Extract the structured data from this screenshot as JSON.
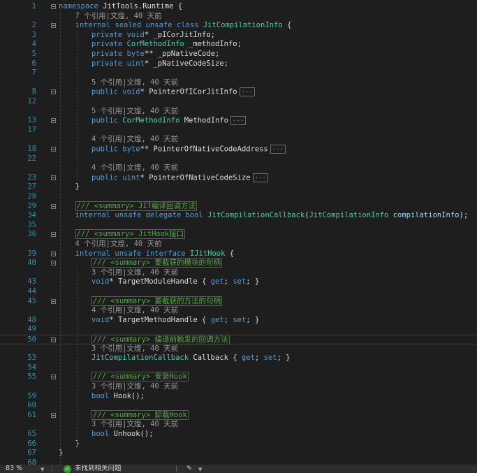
{
  "editor": {
    "lines": [
      {
        "ln": "1",
        "fold": true,
        "code": [
          [
            "kw",
            "namespace"
          ],
          [
            "id",
            " JitTools.Runtime {"
          ]
        ]
      },
      {
        "ln": "",
        "lens": "7 个引用|文煌, 40 天前",
        "indent": 1
      },
      {
        "ln": "2",
        "fold": true,
        "indent": 1,
        "code": [
          [
            "kw",
            "internal sealed unsafe class "
          ],
          [
            "ty",
            "JitCompilationInfo"
          ],
          [
            "id",
            " {"
          ]
        ]
      },
      {
        "ln": "3",
        "indent": 2,
        "code": [
          [
            "kw",
            "private void"
          ],
          [
            "id",
            "* _pICorJitInfo;"
          ]
        ]
      },
      {
        "ln": "4",
        "indent": 2,
        "code": [
          [
            "kw",
            "private "
          ],
          [
            "ty",
            "CorMethodInfo"
          ],
          [
            "id",
            " _methodInfo;"
          ]
        ]
      },
      {
        "ln": "5",
        "indent": 2,
        "code": [
          [
            "kw",
            "private byte"
          ],
          [
            "id",
            "** _ppNativeCode;"
          ]
        ]
      },
      {
        "ln": "6",
        "indent": 2,
        "code": [
          [
            "kw",
            "private uint"
          ],
          [
            "id",
            "* _pNativeCodeSize;"
          ]
        ]
      },
      {
        "ln": "7",
        "code": []
      },
      {
        "ln": "",
        "lens": "5 个引用|文煌, 40 天前",
        "indent": 2
      },
      {
        "ln": "8",
        "fold": true,
        "indent": 2,
        "code": [
          [
            "kw",
            "public void"
          ],
          [
            "id",
            "* PointerOfICorJitInfo"
          ]
        ],
        "collapsed": "..."
      },
      {
        "ln": "12",
        "code": []
      },
      {
        "ln": "",
        "lens": "5 个引用|文煌, 40 天前",
        "indent": 2
      },
      {
        "ln": "13",
        "fold": true,
        "indent": 2,
        "code": [
          [
            "kw",
            "public "
          ],
          [
            "ty",
            "CorMethodInfo"
          ],
          [
            "id",
            " MethodInfo"
          ]
        ],
        "collapsed": "..."
      },
      {
        "ln": "17",
        "code": []
      },
      {
        "ln": "",
        "lens": "4 个引用|文煌, 40 天前",
        "indent": 2
      },
      {
        "ln": "18",
        "fold": true,
        "indent": 2,
        "code": [
          [
            "kw",
            "public byte"
          ],
          [
            "id",
            "** PointerOfNativeCodeAddress"
          ]
        ],
        "collapsed": "..."
      },
      {
        "ln": "22",
        "code": []
      },
      {
        "ln": "",
        "lens": "4 个引用|文煌, 40 天前",
        "indent": 2
      },
      {
        "ln": "23",
        "fold": true,
        "indent": 2,
        "code": [
          [
            "kw",
            "public uint"
          ],
          [
            "id",
            "* PointerOfNativeCodeSize"
          ]
        ],
        "collapsed": "..."
      },
      {
        "ln": "27",
        "indent": 1,
        "code": [
          [
            "id",
            "}"
          ]
        ]
      },
      {
        "ln": "28",
        "code": []
      },
      {
        "ln": "29",
        "fold": true,
        "indent": 1,
        "code": [
          [
            "cmb",
            "/// <summary> JIT编译回调方法"
          ]
        ]
      },
      {
        "ln": "34",
        "indent": 1,
        "code": [
          [
            "kw",
            "internal unsafe delegate bool "
          ],
          [
            "ty",
            "JitCompilationCallback"
          ],
          [
            "id",
            "("
          ],
          [
            "ty",
            "JitCompilationInfo"
          ],
          [
            "pr",
            " compilationInfo"
          ],
          [
            "id",
            ");"
          ]
        ]
      },
      {
        "ln": "35",
        "code": []
      },
      {
        "ln": "36",
        "fold": true,
        "indent": 1,
        "code": [
          [
            "cmb",
            "/// <summary> JitHook接口"
          ]
        ]
      },
      {
        "ln": "",
        "lens": "4 个引用|文煌, 40 天前",
        "indent": 1
      },
      {
        "ln": "39",
        "fold": true,
        "indent": 1,
        "code": [
          [
            "kw",
            "internal unsafe interface "
          ],
          [
            "ty",
            "IJitHook"
          ],
          [
            "id",
            " {"
          ]
        ]
      },
      {
        "ln": "40",
        "fold": true,
        "indent": 2,
        "code": [
          [
            "cmb",
            "/// <summary> 要截获的模块的句柄"
          ]
        ]
      },
      {
        "ln": "",
        "lens": "3 个引用|文煌, 40 天前",
        "indent": 2
      },
      {
        "ln": "43",
        "indent": 2,
        "code": [
          [
            "kw",
            "void"
          ],
          [
            "id",
            "* TargetModuleHandle { "
          ],
          [
            "kw",
            "get"
          ],
          [
            "id",
            "; "
          ],
          [
            "kw",
            "set"
          ],
          [
            "id",
            "; }"
          ]
        ]
      },
      {
        "ln": "44",
        "code": []
      },
      {
        "ln": "45",
        "fold": true,
        "indent": 2,
        "code": [
          [
            "cmb",
            "/// <summary> 要截获的方法的句柄"
          ]
        ]
      },
      {
        "ln": "",
        "lens": "4 个引用|文煌, 40 天前",
        "indent": 2
      },
      {
        "ln": "48",
        "indent": 2,
        "code": [
          [
            "kw",
            "void"
          ],
          [
            "id",
            "* TargetMethodHandle { "
          ],
          [
            "kw",
            "get"
          ],
          [
            "id",
            "; "
          ],
          [
            "kw",
            "set"
          ],
          [
            "id",
            "; }"
          ]
        ]
      },
      {
        "ln": "49",
        "code": []
      },
      {
        "ln": "50",
        "fold": true,
        "indent": 2,
        "sel": true,
        "code": [
          [
            "cmb",
            "/// <summary> 编译前触发的回调方法"
          ]
        ]
      },
      {
        "ln": "",
        "lens": "3 个引用|文煌, 40 天前",
        "indent": 2
      },
      {
        "ln": "53",
        "indent": 2,
        "code": [
          [
            "ty",
            "JitCompilationCallback"
          ],
          [
            "id",
            " Callback { "
          ],
          [
            "kw",
            "get"
          ],
          [
            "id",
            "; "
          ],
          [
            "kw",
            "set"
          ],
          [
            "id",
            "; }"
          ]
        ]
      },
      {
        "ln": "54",
        "code": []
      },
      {
        "ln": "55",
        "fold": true,
        "indent": 2,
        "code": [
          [
            "cmb",
            "/// <summary> 安装Hook"
          ]
        ]
      },
      {
        "ln": "",
        "lens": "3 个引用|文煌, 40 天前",
        "indent": 2
      },
      {
        "ln": "59",
        "indent": 2,
        "code": [
          [
            "kw",
            "bool"
          ],
          [
            "id",
            " Hook();"
          ]
        ]
      },
      {
        "ln": "60",
        "code": []
      },
      {
        "ln": "61",
        "fold": true,
        "indent": 2,
        "code": [
          [
            "cmb",
            "/// <summary> 卸载Hook"
          ]
        ]
      },
      {
        "ln": "",
        "lens": "3 个引用|文煌, 40 天前",
        "indent": 2
      },
      {
        "ln": "65",
        "indent": 2,
        "code": [
          [
            "kw",
            "bool"
          ],
          [
            "id",
            " Unhook();"
          ]
        ]
      },
      {
        "ln": "66",
        "indent": 1,
        "code": [
          [
            "id",
            "}"
          ]
        ]
      },
      {
        "ln": "67",
        "code": [
          [
            "id",
            "}"
          ]
        ]
      },
      {
        "ln": "68",
        "code": []
      }
    ]
  },
  "status": {
    "zoom": "83 %",
    "issues": "未找到相关问题"
  }
}
